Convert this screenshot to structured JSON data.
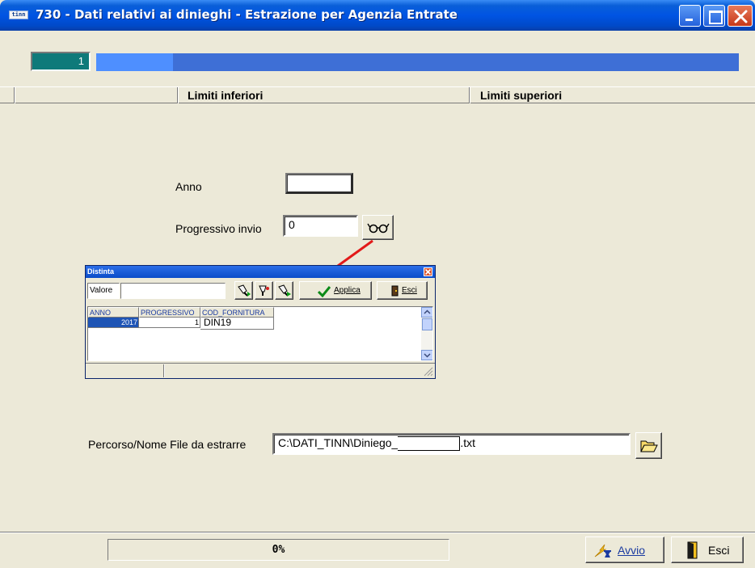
{
  "window": {
    "title": "730 - Dati relativi ai dinieghi - Estrazione per Agenzia Entrate",
    "app_icon_text": "tinn"
  },
  "navigator": {
    "record_number": "1",
    "progress_fraction": 0.12
  },
  "columns": {
    "lower": "Limiti inferiori",
    "upper": "Limiti superiori"
  },
  "form": {
    "anno_label": "Anno",
    "anno_value": "",
    "progressivo_label": "Progressivo invio",
    "progressivo_value": "0",
    "percorso_label": "Percorso/Nome File da estrarre",
    "percorso_value": "C:\\DATI_TINN\\Diniego_",
    "percorso_suffix": ".txt"
  },
  "dialog": {
    "title": "Distinta",
    "valore_label": "Valore",
    "valore_value": "",
    "applica_label": "Applica",
    "esci_label": "Esci",
    "headers": [
      "ANNO",
      "PROGRESSIVO",
      "COD_FORNITURA"
    ],
    "rows": [
      [
        "2017",
        "1",
        "DIN19"
      ]
    ]
  },
  "footer": {
    "progress_text": "0%",
    "avvio_label": "Avvio",
    "esci_label": "Esci"
  },
  "colors": {
    "titlebar": "#0054e3",
    "navigator_counter": "#0f7a7a",
    "navigator_bar": "#3e6fd6",
    "arrow": "#e21a1a",
    "selected_row": "#1e54b5"
  }
}
